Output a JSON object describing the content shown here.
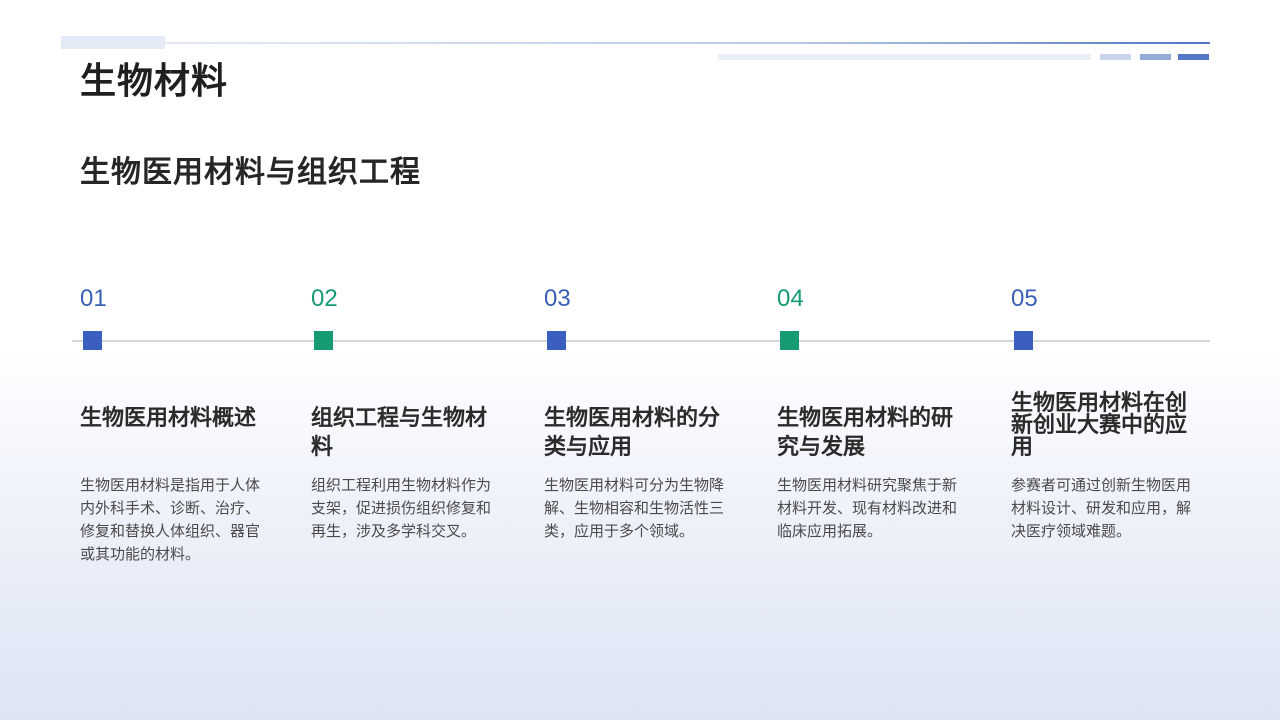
{
  "page": {
    "title": "生物材料",
    "subtitle": "生物医用材料与组织工程"
  },
  "colors": {
    "primary_blue": "#3b5fc0",
    "accent_green": "#179b74",
    "text_dark": "#262626",
    "text_body": "#4a4a4a"
  },
  "steps": [
    {
      "number": "01",
      "heading": "生物医用材料概述",
      "description": "生物医用材料是指用于人体内外科手术、诊断、治疗、修复和替换人体组织、器官或其功能的材料。"
    },
    {
      "number": "02",
      "heading": "组织工程与生物材料",
      "description": "组织工程利用生物材料作为支架，促进损伤组织修复和再生，涉及多学科交叉。"
    },
    {
      "number": "03",
      "heading": "生物医用材料的分类与应用",
      "description": "生物医用材料可分为生物降解、生物相容和生物活性三类，应用于多个领域。"
    },
    {
      "number": "04",
      "heading": "生物医用材料的研究与发展",
      "description": "生物医用材料研究聚焦于新材料开发、现有材料改进和临床应用拓展。"
    },
    {
      "number": "05",
      "heading": "生物医用材料在创新创业大赛中的应用",
      "description": "参赛者可通过创新生物医用材料设计、研发和应用，解决医疗领域难题。"
    }
  ]
}
